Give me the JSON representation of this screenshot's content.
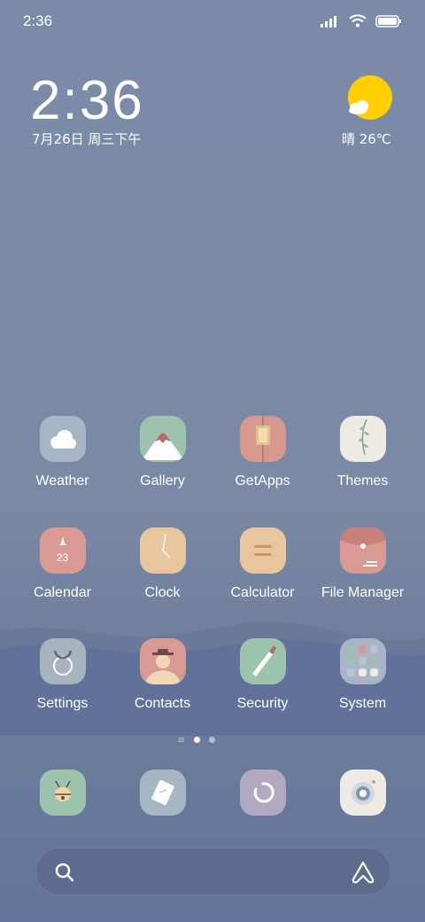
{
  "status": {
    "time": "2:36"
  },
  "clock_widget": {
    "time": "2:36",
    "date": "7月26日 周三下午"
  },
  "weather_widget": {
    "text": "晴 26℃",
    "icon": "sun-cloud-icon"
  },
  "apps": [
    {
      "label": "Weather",
      "icon": "cloud-icon"
    },
    {
      "label": "Gallery",
      "icon": "mountain-icon"
    },
    {
      "label": "GetApps",
      "icon": "store-icon"
    },
    {
      "label": "Themes",
      "icon": "leaf-icon"
    },
    {
      "label": "Calendar",
      "icon": "calendar-icon",
      "badge": "23"
    },
    {
      "label": "Clock",
      "icon": "clock-icon"
    },
    {
      "label": "Calculator",
      "icon": "calculator-icon"
    },
    {
      "label": "File Manager",
      "icon": "folder-icon"
    },
    {
      "label": "Settings",
      "icon": "gear-icon"
    },
    {
      "label": "Contacts",
      "icon": "person-icon"
    },
    {
      "label": "Security",
      "icon": "brush-icon"
    },
    {
      "label": "System",
      "icon": "folder-grid-icon"
    }
  ],
  "page_indicator": {
    "pages": 2,
    "active": 1
  },
  "dock": [
    {
      "icon": "phone-icon"
    },
    {
      "icon": "message-icon"
    },
    {
      "icon": "browser-icon"
    },
    {
      "icon": "camera-icon"
    }
  ],
  "search_bar": {
    "left_icon": "search-icon",
    "right_icon": "assistant-icon"
  },
  "colors": {
    "background": "#7a89a4",
    "sun": "#ffd000"
  }
}
